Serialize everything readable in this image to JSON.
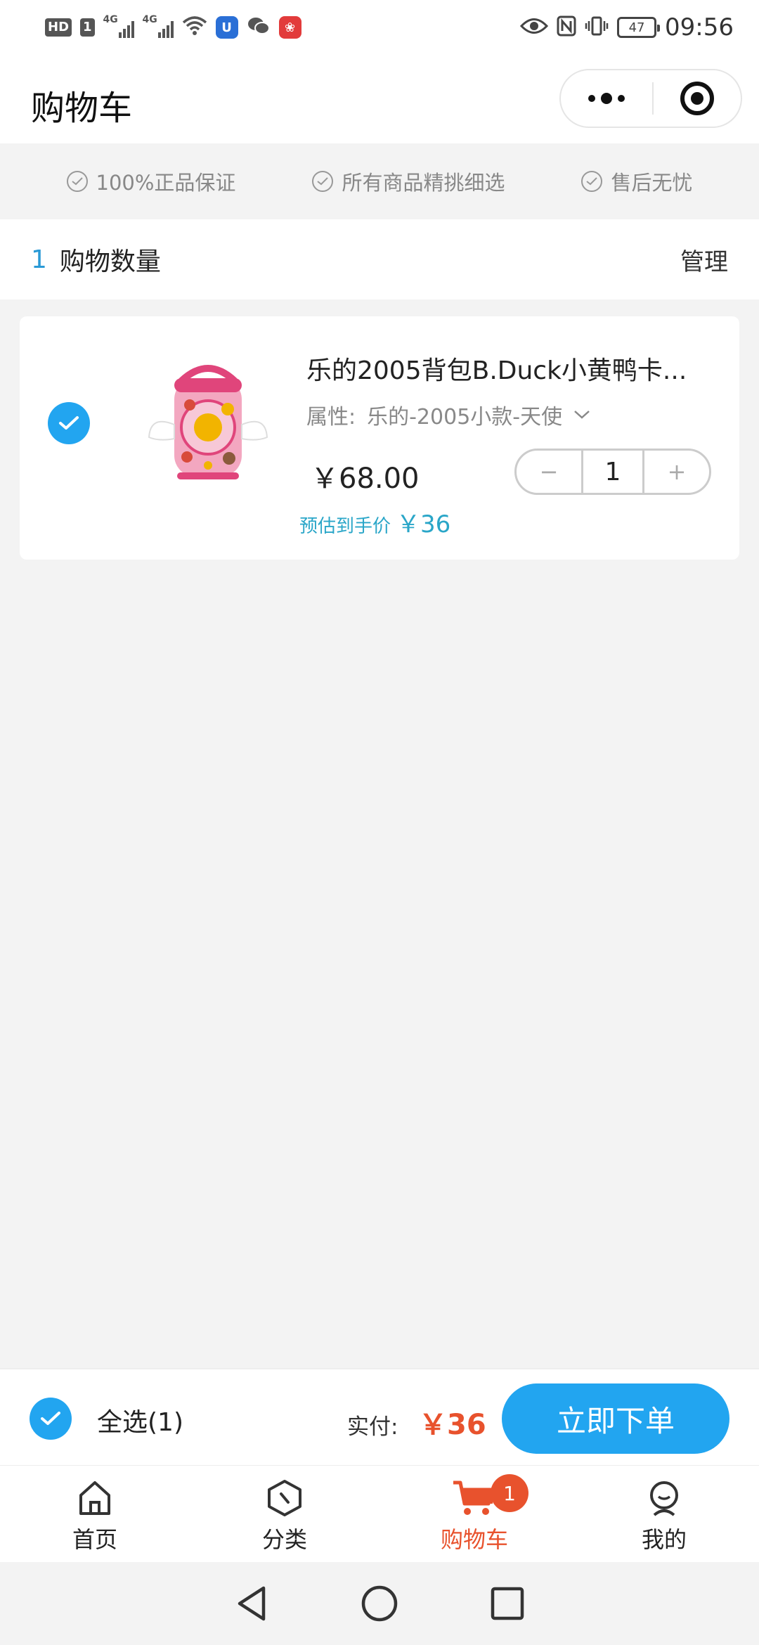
{
  "status_bar": {
    "hd": "HD",
    "sim": "1",
    "net1": "4G",
    "net2": "4G",
    "battery": "47",
    "time": "09:56"
  },
  "header": {
    "title": "购物车"
  },
  "guarantees": [
    {
      "label": "100%正品保证"
    },
    {
      "label": "所有商品精挑细选"
    },
    {
      "label": "售后无忧"
    }
  ],
  "cart_header": {
    "count": "1",
    "label": "购物数量",
    "manage": "管理"
  },
  "item": {
    "title": "乐的2005背包B.Duck小黄鸭卡...",
    "attr_label": "属性:",
    "attr_value": "乐的-2005小款-天使",
    "price": "￥68.00",
    "estimate_label": "预估到手价",
    "estimate_value": "￥36",
    "quantity": "1",
    "minus": "−",
    "plus": "+"
  },
  "checkout": {
    "select_all": "全选(1)",
    "pay_label": "实付:",
    "total": "￥36",
    "order_button": "立即下单"
  },
  "tabs": [
    {
      "label": "首页",
      "icon": "home-icon"
    },
    {
      "label": "分类",
      "icon": "category-icon"
    },
    {
      "label": "购物车",
      "icon": "cart-icon",
      "badge": "1",
      "active": true
    },
    {
      "label": "我的",
      "icon": "profile-icon"
    }
  ],
  "colors": {
    "accent": "#22a5f0",
    "price_highlight": "#e8522d",
    "estimate": "#2aa6c8"
  }
}
